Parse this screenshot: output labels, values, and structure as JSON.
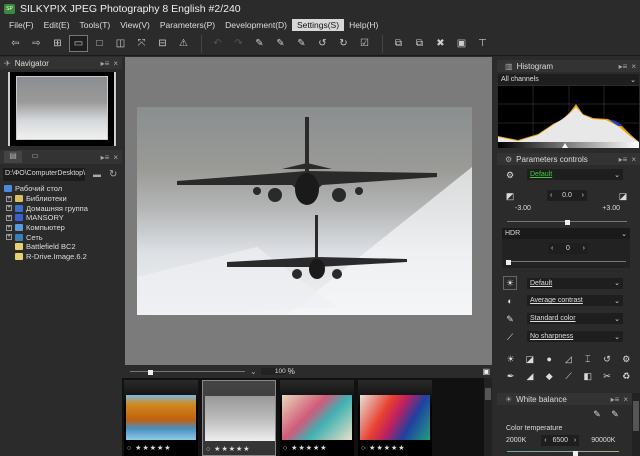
{
  "window": {
    "title": "SILKYPIX JPEG Photography 8 English   #2/240",
    "logo_text": "SP"
  },
  "menu": [
    {
      "label": "File(F)"
    },
    {
      "label": "Edit(E)"
    },
    {
      "label": "Tools(T)"
    },
    {
      "label": "View(V)"
    },
    {
      "label": "Parameters(P)"
    },
    {
      "label": "Development(D)"
    },
    {
      "label": "Settings(S)",
      "active": true
    },
    {
      "label": "Help(H)"
    }
  ],
  "navigator": {
    "title": "Navigator"
  },
  "folder": {
    "path": "D:\\ФО\\ComputerDesktop\\",
    "tree": [
      {
        "label": "Рабочий стол",
        "root": true,
        "color": "#4a8ad8"
      },
      {
        "label": "Библиотеки",
        "color": "#d8c060"
      },
      {
        "label": "Домашняя группа",
        "color": "#3a70c8"
      },
      {
        "label": "MANSORY",
        "color": "#3a60d0"
      },
      {
        "label": "Компьютер",
        "color": "#5a9ad8"
      },
      {
        "label": "Сеть",
        "color": "#3a80b8"
      },
      {
        "label": "Battlefield BC2",
        "leaf": true,
        "color": "#e8d070"
      },
      {
        "label": "R-Drive.Image.6.2",
        "leaf": true,
        "color": "#e8d070"
      }
    ]
  },
  "zoom": {
    "value": "100",
    "unit": "%"
  },
  "filmstrip": [
    {
      "name": "autumn-lake",
      "rating": 5
    },
    {
      "name": "jets",
      "rating": 5,
      "selected": true
    },
    {
      "name": "paper-cranes",
      "rating": 5
    },
    {
      "name": "colored-pencils",
      "rating": 5
    }
  ],
  "histogram": {
    "title": "Histogram",
    "channel": "All channels"
  },
  "params": {
    "title": "Parameters controls",
    "preset": "Default",
    "exposure": "0.0",
    "exposure_min": "-3.00",
    "exposure_max": "+3.00",
    "exposure_fraction": 0.5,
    "hdr_label": "HDR",
    "hdr_value": "0",
    "tone": "Default",
    "contrast": "Average contrast",
    "color": "Standard color",
    "sharpness": "No sharpness"
  },
  "white_balance": {
    "title": "White balance",
    "color_temp_label": "Color temperature",
    "min": "2000K",
    "value": "6500",
    "max": "90000K"
  },
  "colors": {
    "accent_green": "#3cc83c",
    "bg": "#2b2b2b",
    "selected_menu": "#d8d8d8"
  }
}
